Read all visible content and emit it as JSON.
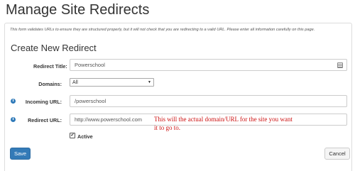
{
  "page": {
    "title": "Manage Site Redirects"
  },
  "notice": "This form validates URLs to ensure they are structured properly, but it will not check that you are redirecting to a valid URL. Please enter all information carefully on this page.",
  "form": {
    "heading": "Create New Redirect",
    "redirect_title": {
      "label": "Redirect Title:",
      "value": "Powerschool"
    },
    "domains": {
      "label": "Domains:",
      "selected": "All"
    },
    "incoming_url": {
      "label": "Incoming URL:",
      "value": "/powerschool"
    },
    "redirect_url": {
      "label": "Redirect URL:",
      "value": "http://www.powerschool.com"
    },
    "active": {
      "label": "Active",
      "checked": true,
      "mark": "✔"
    }
  },
  "annotation": {
    "line1": "This will the actual domain/URL for the site you want",
    "line2": "it to go to."
  },
  "buttons": {
    "save": "Save",
    "cancel": "Cancel"
  },
  "icons": {
    "info": "info-circle-icon",
    "contacts": "address-book-icon",
    "dropdown": "chevron-down-icon"
  },
  "colors": {
    "primary_button": "#337ab7",
    "info_icon": "#2f7ab9",
    "annotation": "#cc1111"
  }
}
